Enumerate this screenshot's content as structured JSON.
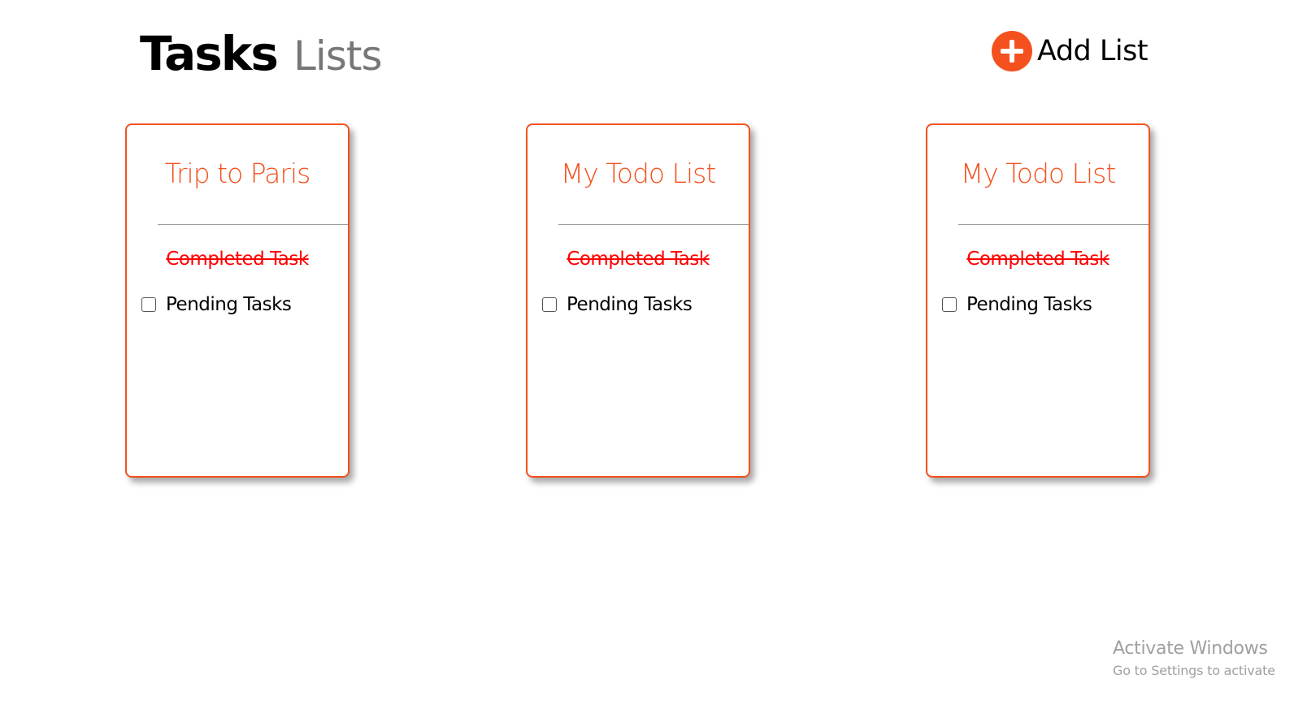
{
  "header": {
    "title_strong": "Tasks",
    "title_light": "Lists",
    "add_list_label": "Add List",
    "add_list_icon": "plus-circle-icon"
  },
  "colors": {
    "accent": "#f4511e",
    "completed": "#ff0000"
  },
  "lists": [
    {
      "title": "Trip to Paris",
      "completed_tasks": [
        "Completed Task"
      ],
      "pending_tasks": [
        {
          "label": "Pending Tasks",
          "checked": false
        }
      ]
    },
    {
      "title": "My Todo List",
      "completed_tasks": [
        "Completed Task"
      ],
      "pending_tasks": [
        {
          "label": "Pending Tasks",
          "checked": false
        }
      ]
    },
    {
      "title": "My Todo List",
      "completed_tasks": [
        "Completed Task"
      ],
      "pending_tasks": [
        {
          "label": "Pending Tasks",
          "checked": false
        }
      ]
    }
  ],
  "watermark": {
    "title": "Activate Windows",
    "subtitle": "Go to Settings to activate"
  }
}
